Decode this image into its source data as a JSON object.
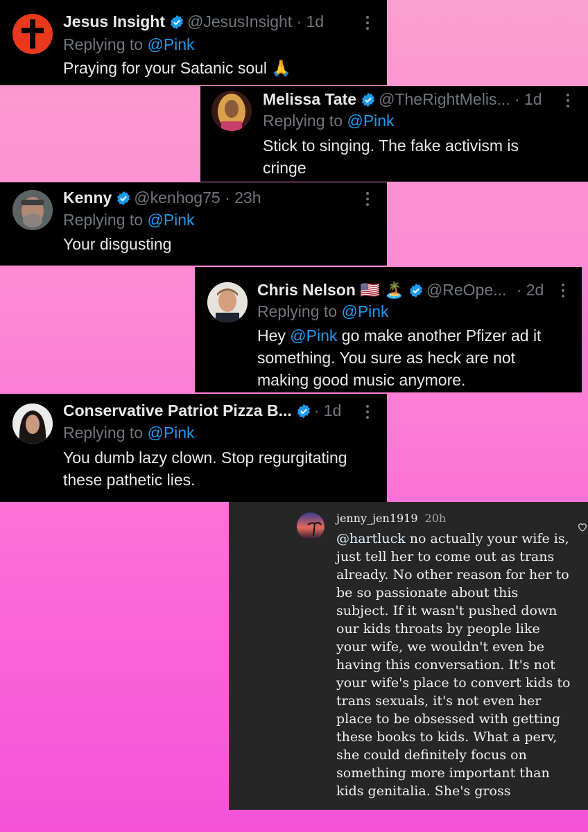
{
  "tweets": [
    {
      "name": "Jesus Insight",
      "handle": "@JesusInsight",
      "time": "· 1d",
      "replying_prefix": "Replying to",
      "replying_to": "@Pink",
      "text": "Praying for your Satanic soul 🙏"
    },
    {
      "name": "Melissa Tate",
      "handle": "@TheRightMelis...",
      "time": "· 1d",
      "replying_prefix": "Replying to",
      "replying_to": "@Pink",
      "text_line1": "Stick to singing. The fake activism is",
      "text_line2": "cringe"
    },
    {
      "name": "Kenny",
      "handle": "@kenhog75",
      "time": "· 23h",
      "replying_prefix": "Replying to",
      "replying_to": "@Pink",
      "text": "Your disgusting"
    },
    {
      "name": "Chris Nelson 🇺🇸 🏝️",
      "handle": "@ReOpe...",
      "time": "· 2d",
      "replying_prefix": "Replying to",
      "replying_to": "@Pink",
      "text_pre": "Hey ",
      "text_mention": "@Pink",
      "text_post": " go make another Pfizer ad it",
      "text_line2": "something. You sure as heck are not",
      "text_line3": "making good music anymore."
    },
    {
      "name": "Conservative Patriot Pizza B...",
      "handle": "",
      "time": "· 1d",
      "replying_prefix": "Replying to",
      "replying_to": "@Pink",
      "text_line1": "You dumb lazy clown. Stop regurgitating",
      "text_line2": "these pathetic lies."
    }
  ],
  "instagram_comment": {
    "username": "jenny_jen1919",
    "time": "20h",
    "mention": "@hartluck",
    "text": " no actually your wife is, just tell her to come out as trans already. No other reason for her to be so passionate about this subject. If it wasn't pushed down our kids throats by people like your wife, we wouldn't even be having this conversation. It's not your wife's place to convert kids to trans sexuals, it's not even her place to be obsessed with getting these books to kids. What a perv, she could definitely focus on something more important than kids genitalia. She's gross"
  },
  "colors": {
    "verified_blue": "#1d9bf0",
    "mention_blue": "#1d9bf0",
    "card_bg": "#000000",
    "ig_bg": "#262626"
  },
  "icons": [
    "verified-badge-icon",
    "more-options-icon",
    "heart-icon"
  ]
}
